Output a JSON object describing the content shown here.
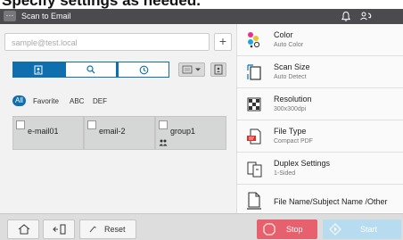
{
  "caption": "Specify settings as needed.",
  "title_bar": {
    "title": "Scan to Email",
    "menu_icon": "ellipsis-icon",
    "notification_icon": "bell-icon",
    "switch_icon": "user-switch-icon"
  },
  "address": {
    "placeholder": "sample@test.local",
    "add_label": "+"
  },
  "tabs": [
    {
      "icon": "address-book-icon",
      "selected": true
    },
    {
      "icon": "search-icon",
      "selected": false
    },
    {
      "icon": "history-clock-icon",
      "selected": false
    }
  ],
  "filters": {
    "all": "All",
    "favorite": "Favorite",
    "abc": "ABC",
    "def": "DEF"
  },
  "entries": [
    {
      "label": "e-mail01"
    },
    {
      "label": "email-2"
    },
    {
      "label": "group1",
      "icon": "group-icon"
    }
  ],
  "settings": [
    {
      "title": "Color",
      "value": "Auto Color",
      "icon": "color-icon"
    },
    {
      "title": "Scan Size",
      "value": "Auto Detect",
      "icon": "scan-size-icon"
    },
    {
      "title": "Resolution",
      "value": "300x300dpi",
      "icon": "resolution-icon"
    },
    {
      "title": "File Type",
      "value": "Compact PDF",
      "icon": "pdf-file-icon"
    },
    {
      "title": "Duplex Settings",
      "value": "1-Sided",
      "icon": "duplex-icon"
    },
    {
      "title": "File Name/Subject Name /Other",
      "value": "",
      "icon": "document-icon"
    }
  ],
  "bottom": {
    "home_icon": "home-icon",
    "back_icon": "back-icon",
    "reset_label": "Reset",
    "stop_label": "Stop",
    "start_label": "Start"
  },
  "colors": {
    "accent": "#0f6fae",
    "stop": "#e6616d",
    "start_disabled": "#b7dbef",
    "title_bar": "#4a4a4f"
  }
}
